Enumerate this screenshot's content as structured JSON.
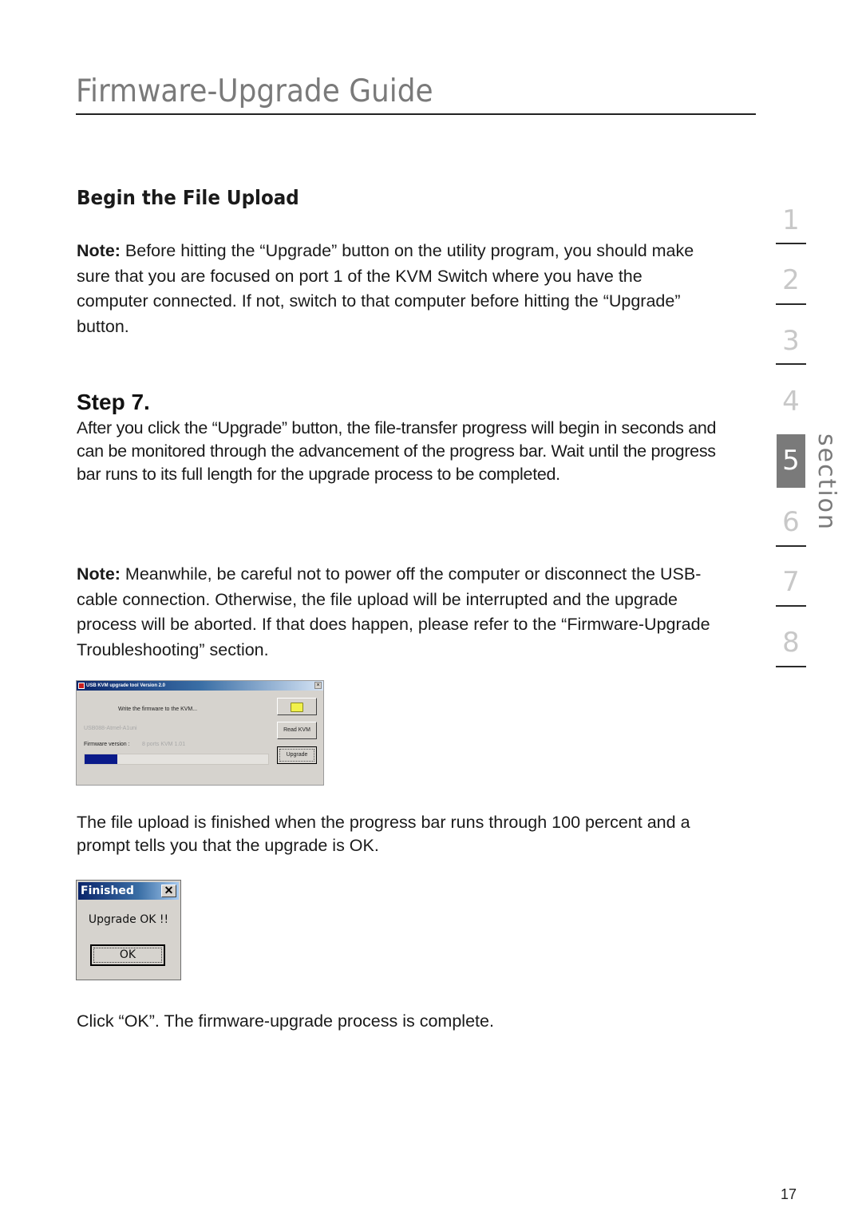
{
  "header": {
    "title": "Firmware-Upgrade Guide"
  },
  "content": {
    "section_heading": "Begin the File Upload",
    "note1": {
      "label": "Note:",
      "text": " Before hitting the “Upgrade” button on the utility program, you should make sure that you are focused on port 1 of the KVM Switch where you have the computer connected. If not, switch to that computer before hitting the “Upgrade” button."
    },
    "step_heading": "Step 7.",
    "step_text": "After you click the “Upgrade” button, the file-transfer progress will begin in seconds and can be monitored through the advancement of the progress bar.  Wait until the progress bar runs to its full length for the upgrade process to be completed.",
    "note2": {
      "label": "Note:",
      "text": " Meanwhile, be careful not to power off the computer or disconnect the USB-cable connection. Otherwise, the file upload will be interrupted and the upgrade process will be aborted. If that does happen, please refer to the “Firmware-Upgrade Troubleshooting” section."
    },
    "finished_text": "The file upload is finished when the progress bar runs through 100 percent and a prompt tells you that the upgrade is OK.",
    "click_text": "Click “OK”. The firmware-upgrade process is complete."
  },
  "upgrade_tool": {
    "title": "USB KVM upgrade tool Version 2.0",
    "close_glyph": "×",
    "status_text": "Write the firmware to the KVM...",
    "device_text": "USB088-Atmel-A1uni",
    "firmware_label": "Firmware version :",
    "firmware_value": "8 ports KVM 1.01",
    "read_button": "Read KVM",
    "upgrade_button": "Upgrade",
    "progress_percent": 18
  },
  "finished_dialog": {
    "title": "Finished",
    "close_glyph": "✕",
    "message": "Upgrade OK !!",
    "ok_button": "OK"
  },
  "section_nav": {
    "items": [
      "1",
      "2",
      "3",
      "4",
      "5",
      "6",
      "7",
      "8"
    ],
    "active": "5",
    "label": "section"
  },
  "footer": {
    "page_number": "17"
  },
  "colors": {
    "title_gray": "#7a7a7a",
    "nav_inactive": "#c8c8c8",
    "nav_active_bg": "#7a7a7a",
    "progress_fill": "#0a1a8a"
  }
}
